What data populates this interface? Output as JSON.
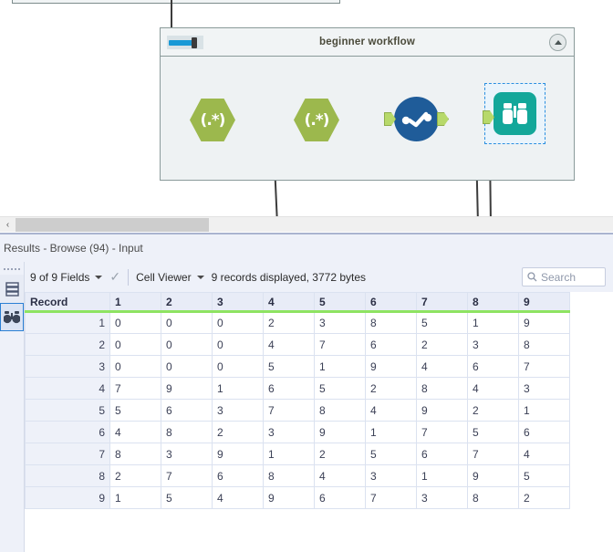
{
  "canvas": {
    "container": {
      "title": "beginner workflow",
      "slider_name": "container-size-slider",
      "collapse_label": "collapse"
    },
    "tools": [
      {
        "name": "regex-tool-1",
        "label": "(.*)",
        "type": "hexagon",
        "color": "#9cb84d"
      },
      {
        "name": "regex-tool-2",
        "label": "(.*)",
        "type": "hexagon",
        "color": "#9cb84d"
      },
      {
        "name": "select-tool",
        "label": "",
        "type": "circle",
        "color": "#1f5c99"
      },
      {
        "name": "browse-tool",
        "label": "",
        "type": "browse",
        "color": "#13a79a"
      }
    ]
  },
  "scrollbar": {
    "left_arrow": "‹"
  },
  "results": {
    "title": "Results - Browse (94) - Input",
    "rail": [
      {
        "name": "table-view-icon",
        "label": "table"
      },
      {
        "name": "browse-icon",
        "label": "browse",
        "active": true
      }
    ],
    "toolbar": {
      "fields": "9 of 9 Fields",
      "check_glyph": "✓",
      "viewer": "Cell Viewer",
      "status": "9 records displayed, 3772 bytes",
      "search_placeholder": "Search",
      "search_value": ""
    },
    "table": {
      "record_header": "Record",
      "columns": [
        "1",
        "2",
        "3",
        "4",
        "5",
        "6",
        "7",
        "8",
        "9"
      ],
      "rows": [
        {
          "record": "1",
          "values": [
            "0",
            "0",
            "0",
            "2",
            "3",
            "8",
            "5",
            "1",
            "9"
          ]
        },
        {
          "record": "2",
          "values": [
            "0",
            "0",
            "0",
            "4",
            "7",
            "6",
            "2",
            "3",
            "8"
          ]
        },
        {
          "record": "3",
          "values": [
            "0",
            "0",
            "0",
            "5",
            "1",
            "9",
            "4",
            "6",
            "7"
          ]
        },
        {
          "record": "4",
          "values": [
            "7",
            "9",
            "1",
            "6",
            "5",
            "2",
            "8",
            "4",
            "3"
          ]
        },
        {
          "record": "5",
          "values": [
            "5",
            "6",
            "3",
            "7",
            "8",
            "4",
            "9",
            "2",
            "1"
          ]
        },
        {
          "record": "6",
          "values": [
            "4",
            "8",
            "2",
            "3",
            "9",
            "1",
            "7",
            "5",
            "6"
          ]
        },
        {
          "record": "7",
          "values": [
            "8",
            "3",
            "9",
            "1",
            "2",
            "5",
            "6",
            "7",
            "4"
          ]
        },
        {
          "record": "8",
          "values": [
            "2",
            "7",
            "6",
            "8",
            "4",
            "3",
            "1",
            "9",
            "5"
          ]
        },
        {
          "record": "9",
          "values": [
            "1",
            "5",
            "4",
            "9",
            "6",
            "7",
            "3",
            "8",
            "2"
          ]
        }
      ]
    }
  },
  "colors": {
    "tool_green": "#9cb84d",
    "port_green": "#b7d96a",
    "select_blue": "#1f5c99",
    "browse_teal": "#13a79a",
    "header_underline": "#8ee362",
    "selection_blue": "#2a8fe0"
  }
}
